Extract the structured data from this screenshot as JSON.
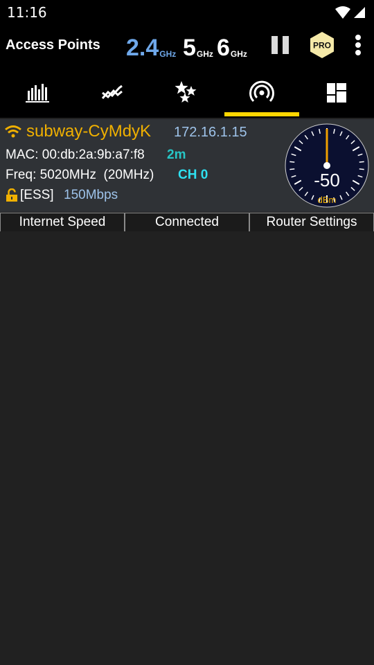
{
  "status": {
    "time": "11:16",
    "icons": [
      "wifi-signal-icon",
      "cell-signal-icon"
    ]
  },
  "appbar": {
    "title": "Access Points",
    "bands": [
      {
        "num": "2.4",
        "unit": "GHz",
        "color": "#6fa8ea"
      },
      {
        "num": "5",
        "unit": "GHz",
        "color": "#ffffff"
      },
      {
        "num": "6",
        "unit": "GHz",
        "color": "#ffffff"
      }
    ],
    "pro_label": "PRO",
    "icons": [
      "pause-icon",
      "pro-badge-icon",
      "more-vert-icon"
    ]
  },
  "tabs": [
    {
      "icon": "channel-graph-icon"
    },
    {
      "icon": "time-graph-icon"
    },
    {
      "icon": "channel-rating-icon"
    },
    {
      "icon": "access-points-icon",
      "active": true
    },
    {
      "icon": "export-icon"
    }
  ],
  "access_point": {
    "ssid": "subway-CyMdyK",
    "ip": "172.16.1.15",
    "mac_line": "MAC: 00:db:2a:9b:a7:f8",
    "distance": "2m",
    "freq_line": "Freq: 5020MHz  (20MHz)",
    "channel": "CH 0",
    "security": "[ESS]",
    "rate": "150Mbps",
    "signal": {
      "value": -50,
      "value_label": "-50",
      "unit": "dBm"
    }
  },
  "actions": {
    "internet_speed": "Internet Speed",
    "connected": "Connected",
    "router_settings": "Router Settings"
  },
  "colors": {
    "accent": "#ffd600",
    "ssid": "#f0b000",
    "ip": "#9ec3ea",
    "distance": "#27c6c6",
    "channel": "#2ee0f0",
    "background": "#212121",
    "card": "#2f3236"
  }
}
